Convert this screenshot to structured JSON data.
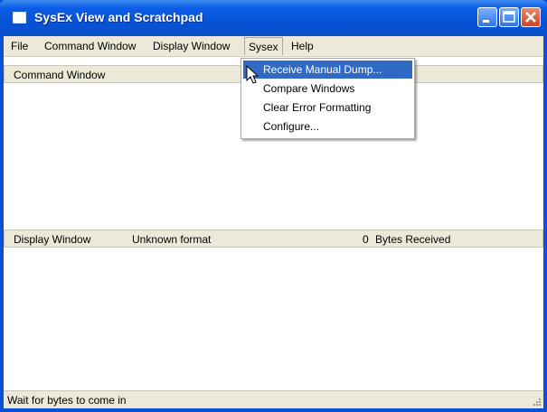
{
  "window": {
    "title": "SysEx View and Scratchpad"
  },
  "menubar": {
    "items": [
      "File",
      "Command Window",
      "Display Window",
      "Sysex",
      "Help"
    ],
    "active": "Sysex"
  },
  "sysex_menu": {
    "items": [
      "Receive Manual Dump...",
      "Compare Windows",
      "Clear Error Formatting",
      "Configure..."
    ],
    "highlighted": "Receive Manual Dump..."
  },
  "command_pane": {
    "header": "Command Window"
  },
  "display_pane": {
    "header": "Display Window",
    "format": "Unknown format",
    "bytes_count": "0",
    "bytes_label": "Bytes Received"
  },
  "status": {
    "text": "Wait for bytes to come in"
  },
  "colors": {
    "titlebar": "#0653d6",
    "menu_highlight": "#316ac5",
    "chrome": "#ece9d8",
    "close_button": "#c8452a"
  },
  "icons": [
    "app-icon",
    "minimize-icon",
    "maximize-icon",
    "close-icon",
    "mouse-cursor-icon",
    "resize-grip-icon"
  ]
}
